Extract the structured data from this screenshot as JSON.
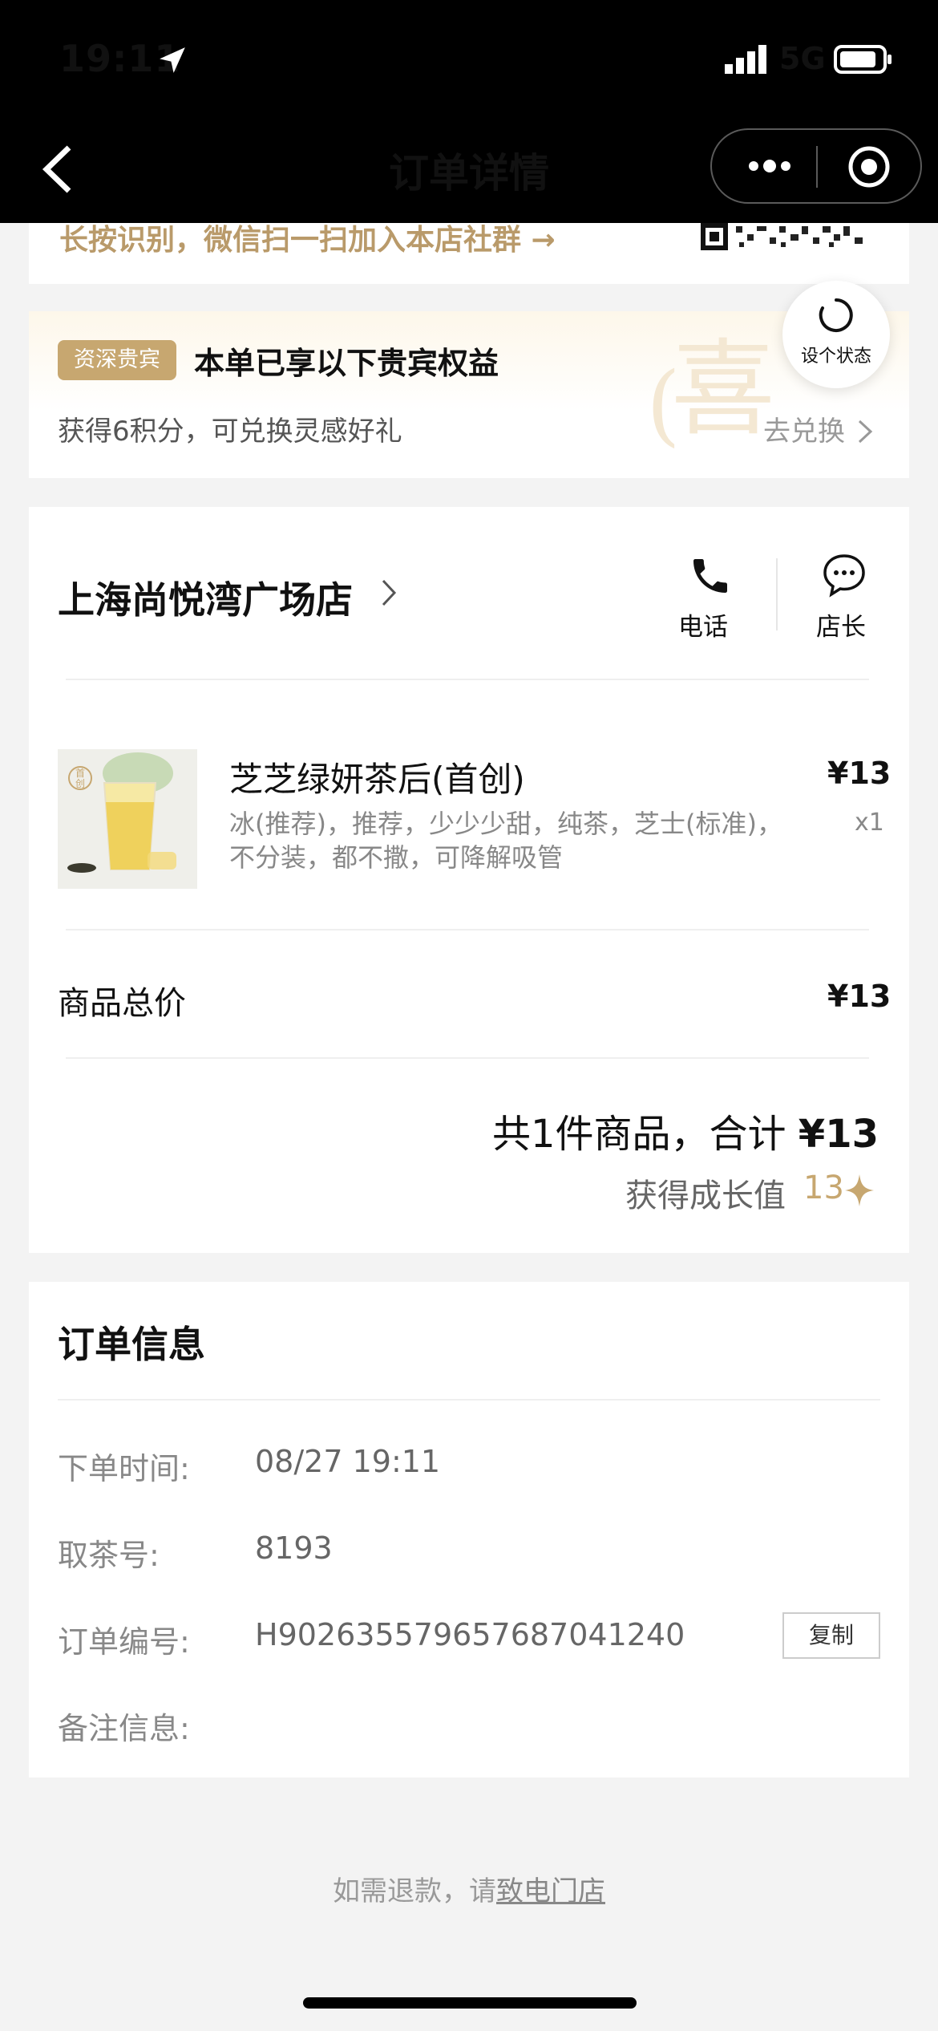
{
  "status_bar": {
    "time": "19:11",
    "network": "5G"
  },
  "nav": {
    "title": "订单详情"
  },
  "qr_banner": {
    "text": "长按识别，微信扫一扫加入本店社群 →"
  },
  "vip": {
    "badge": "资深贵宾",
    "title": "本单已享以下贵宾权益",
    "subtitle": "获得6积分，可兑换灵感好礼",
    "link": "去兑换",
    "watermark": "喜"
  },
  "float_button": {
    "label": "设个状态"
  },
  "store": {
    "name": "上海尚悦湾广场店",
    "phone_label": "电话",
    "manager_label": "店长"
  },
  "product": {
    "name": "芝芝绿妍茶后(首创)",
    "price": "¥13",
    "options_line1": "冰(推荐)，推荐，少少少甜，纯茶，芝士(标准)，",
    "options_line2": "不分装，都不撒，可降解吸管",
    "qty": "x1",
    "tag": "首创"
  },
  "totals": {
    "label": "商品总价",
    "value": "¥13",
    "summary_prefix": "共1件商品，合计 ",
    "summary_amount": "¥13",
    "growth_label": "获得成长值",
    "growth_value": "13"
  },
  "order_info": {
    "title": "订单信息",
    "time_label": "下单时间:",
    "time_value": "08/27 19:11",
    "pickup_label": "取茶号:",
    "pickup_value": "8193",
    "order_no_label": "订单编号:",
    "order_no_value": "H902635579657687041240",
    "copy_label": "复制",
    "note_label": "备注信息:"
  },
  "footer": {
    "prefix": "如需退款，请",
    "link": "致电门店"
  },
  "colors": {
    "gold": "#c7a770",
    "gold_text": "#b99a6a"
  },
  "icons": [
    "location-arrow-icon",
    "signal-icon",
    "battery-icon",
    "back-icon",
    "more-icon",
    "target-icon",
    "qr-code-icon",
    "chevron-right-icon",
    "refresh-icon",
    "phone-icon",
    "chat-icon",
    "sparkle-icon"
  ]
}
